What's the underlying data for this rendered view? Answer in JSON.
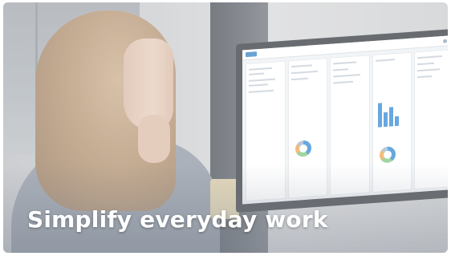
{
  "card": {
    "headline": "Simplify everyday work"
  },
  "image": {
    "subject": "person-at-monitor-photo",
    "screen_app": "dashboard-tiles"
  },
  "colors": {
    "headline_text": "#ffffff",
    "chart_accent": "#2f86d3"
  }
}
